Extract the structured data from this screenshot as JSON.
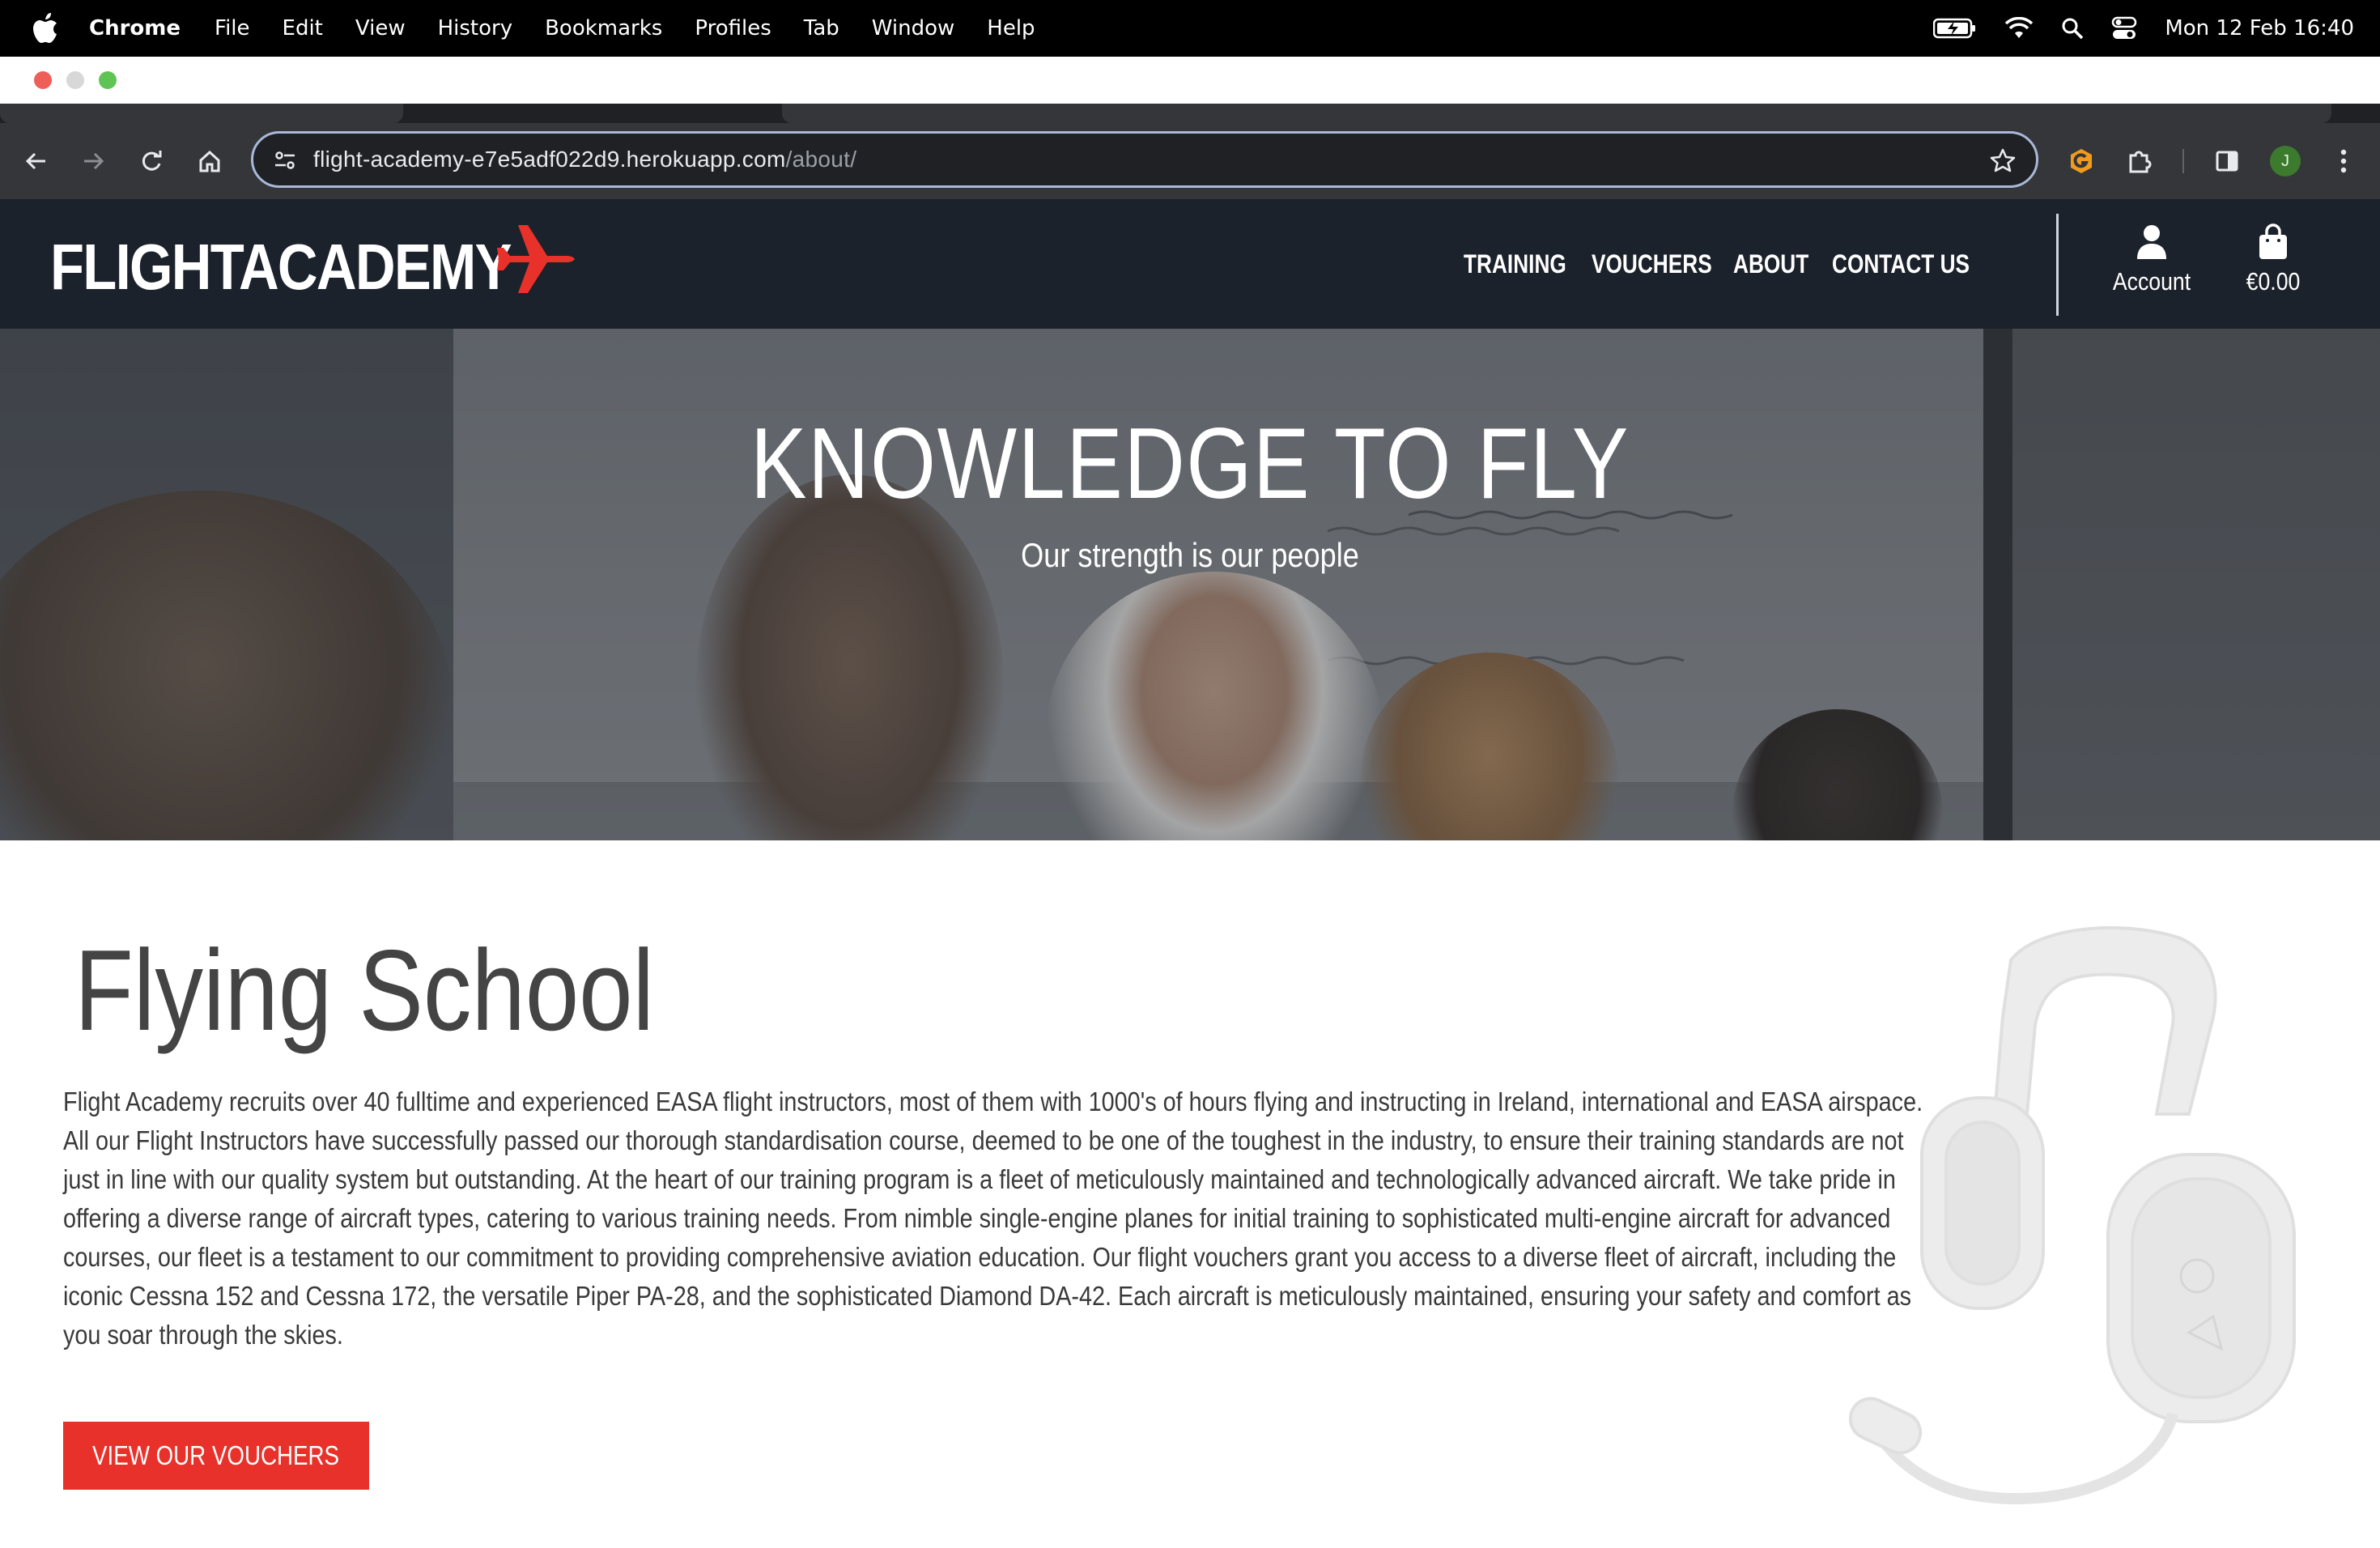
{
  "menubar": {
    "app_name": "Chrome",
    "items": [
      "File",
      "Edit",
      "View",
      "History",
      "Bookmarks",
      "Profiles",
      "Tab",
      "Window",
      "Help"
    ],
    "clock": "Mon 12 Feb  16:40",
    "icons": [
      "apple-icon",
      "battery-icon",
      "wifi-icon",
      "spotlight-icon",
      "control-center-icon"
    ]
  },
  "browser": {
    "url_host": "flight-academy-e7e5adf022d9.herokuapp.com",
    "url_path": "/about/",
    "profile_initial": "J",
    "colors": {
      "profile": "#3c7a2e",
      "extension": "#f29b1d",
      "focus_ring": "#a9b8d8"
    }
  },
  "site": {
    "logo": "FLIGHTACADEMY",
    "nav": [
      "TRAINING",
      "VOUCHERS",
      "ABOUT",
      "CONTACT US"
    ],
    "account_label": "Account",
    "cart_total": "€0.00",
    "colors": {
      "header_bg": "#1c222b",
      "accent": "#e8312a"
    }
  },
  "hero": {
    "title": "KNOWLEDGE TO FLY",
    "subtitle": "Our strength is our people"
  },
  "main": {
    "title": "Flying School",
    "body": "Flight Academy recruits over 40 fulltime and experienced EASA flight instructors, most of them with 1000's of hours flying and instructing in Ireland, international and EASA airspace. All our Flight Instructors have successfully passed our thorough standardisation course, deemed to be one of the toughest in the industry, to ensure their training standards are not just in line with our quality system but outstanding. At the heart of our training program is a fleet of meticulously maintained and technologically advanced aircraft. We take pride in offering a diverse range of aircraft types, catering to various training needs. From nimble single-engine planes for initial training to sophisticated multi-engine aircraft for advanced courses, our fleet is a testament to our commitment to providing comprehensive aviation education. Our flight vouchers grant you access to a diverse fleet of aircraft, including the iconic Cessna 152 and Cessna 172, the versatile Piper PA-28, and the sophisticated Diamond DA-42. Each aircraft is meticulously maintained, ensuring your safety and comfort as you soar through the skies.",
    "cta": "VIEW OUR VOUCHERS"
  }
}
